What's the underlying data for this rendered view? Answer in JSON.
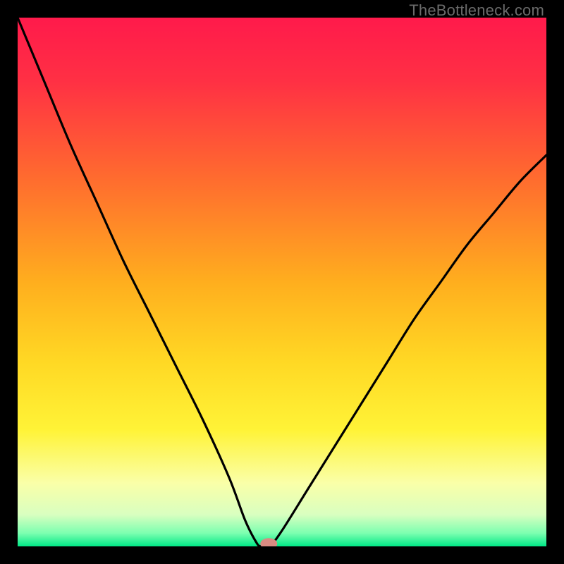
{
  "watermark": "TheBottleneck.com",
  "chart_data": {
    "type": "line",
    "title": "",
    "xlabel": "",
    "ylabel": "",
    "xlim": [
      0,
      100
    ],
    "ylim": [
      0,
      100
    ],
    "min_point_x": 46,
    "series": [
      {
        "name": "curve",
        "x": [
          0,
          5,
          10,
          15,
          20,
          25,
          30,
          35,
          40,
          43,
          45,
          46,
          48,
          50,
          55,
          60,
          65,
          70,
          75,
          80,
          85,
          90,
          95,
          100
        ],
        "y": [
          100,
          88,
          76,
          65,
          54,
          44,
          34,
          24,
          13,
          5,
          1,
          0,
          0.5,
          3,
          11,
          19,
          27,
          35,
          43,
          50,
          57,
          63,
          69,
          74
        ]
      }
    ],
    "marker": {
      "x": 47.5,
      "y": 0.5
    },
    "gradient_stops": [
      {
        "offset": 0.0,
        "color": "#ff1a4b"
      },
      {
        "offset": 0.12,
        "color": "#ff3044"
      },
      {
        "offset": 0.3,
        "color": "#ff6a2f"
      },
      {
        "offset": 0.5,
        "color": "#ffae1e"
      },
      {
        "offset": 0.65,
        "color": "#ffd824"
      },
      {
        "offset": 0.78,
        "color": "#fff337"
      },
      {
        "offset": 0.88,
        "color": "#faffa8"
      },
      {
        "offset": 0.94,
        "color": "#d9ffc0"
      },
      {
        "offset": 0.975,
        "color": "#7cffb0"
      },
      {
        "offset": 1.0,
        "color": "#00e887"
      }
    ]
  }
}
